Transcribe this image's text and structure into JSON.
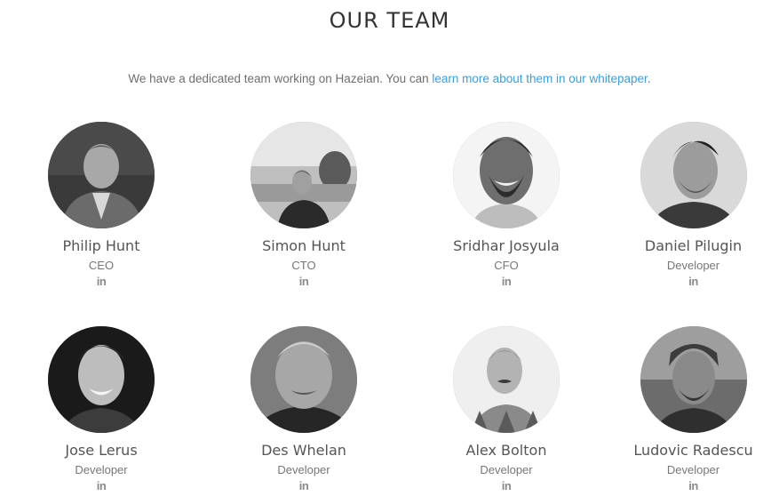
{
  "section": {
    "title": "OUR TEAM",
    "intro_text": "We have a dedicated team working on Hazeian. You can ",
    "intro_link": "learn more about them in our whitepaper",
    "intro_end": "."
  },
  "linkedin_label": "in",
  "members": [
    {
      "name": "Philip Hunt",
      "role": "CEO"
    },
    {
      "name": "Simon Hunt",
      "role": "CTO"
    },
    {
      "name": "Sridhar Josyula",
      "role": "CFO"
    },
    {
      "name": "Daniel Pilugin",
      "role": "Developer"
    },
    {
      "name": "Jose Lerus",
      "role": "Developer"
    },
    {
      "name": "Des Whelan",
      "role": "Developer"
    },
    {
      "name": "Alex Bolton",
      "role": "Developer"
    },
    {
      "name": "Ludovic Radescu",
      "role": "Developer"
    }
  ],
  "colors": {
    "title": "#333333",
    "text": "#6f6f6f",
    "link": "#3d9dd9",
    "icon": "#8a8a8a"
  }
}
